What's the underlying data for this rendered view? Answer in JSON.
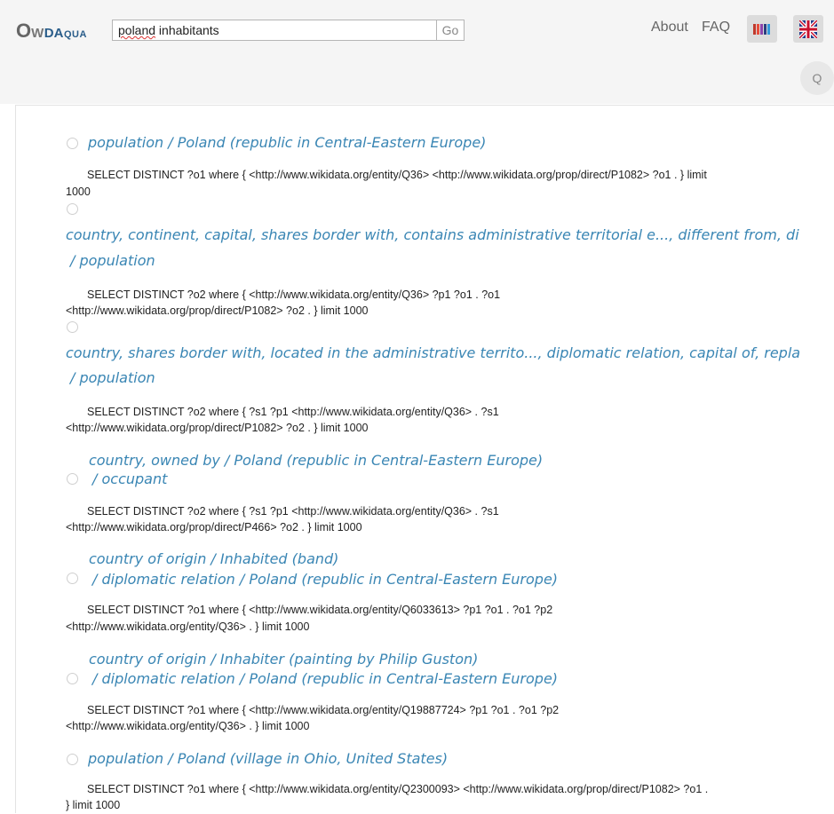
{
  "header": {
    "logo": {
      "o": "O",
      "w": "W",
      "d": "D",
      "aqua": "Aqua"
    },
    "search": {
      "value_word": "poland",
      "value_rest": " inhabitants"
    },
    "go_label": "Go",
    "about_label": "About",
    "faq_label": "FAQ",
    "q_label": "Q"
  },
  "results": [
    {
      "title1": "population / Poland (republic in Central-Eastern Europe)",
      "query1": "SELECT DISTINCT ?o1 where { <http://www.wikidata.org/entity/Q36> <http://www.wikidata.org/prop/direct/P1082> ?o1 . } limit",
      "query2": "1000"
    },
    {
      "title1": "country, continent, capital, shares border with, contains administrative territorial e..., different from, di",
      "title2": "/ population",
      "query1": "SELECT DISTINCT ?o2 where { <http://www.wikidata.org/entity/Q36> ?p1 ?o1 . ?o1",
      "query2": "<http://www.wikidata.org/prop/direct/P1082> ?o2 . } limit 1000"
    },
    {
      "title1": "country, shares border with, located in the administrative territo..., diplomatic relation, capital of, repla",
      "title2": "/ population",
      "query1": "SELECT DISTINCT ?o2 where { ?s1 ?p1 <http://www.wikidata.org/entity/Q36> . ?s1",
      "query2": "<http://www.wikidata.org/prop/direct/P1082> ?o2 . } limit 1000"
    },
    {
      "title1": "country, owned by / Poland (republic in Central-Eastern Europe)",
      "title2": "/ occupant",
      "query1": "SELECT DISTINCT ?o2 where { ?s1 ?p1 <http://www.wikidata.org/entity/Q36> . ?s1",
      "query2": "<http://www.wikidata.org/prop/direct/P466> ?o2 . } limit 1000"
    },
    {
      "title1": "country of origin / Inhabited (band)",
      "title2": "/ diplomatic relation / Poland (republic in Central-Eastern Europe)",
      "query1": "SELECT DISTINCT ?o1 where { <http://www.wikidata.org/entity/Q6033613> ?p1 ?o1 . ?o1 ?p2",
      "query2": "<http://www.wikidata.org/entity/Q36> . } limit 1000"
    },
    {
      "title1": "country of origin / Inhabiter (painting by Philip Guston)",
      "title2": "/ diplomatic relation / Poland (republic in Central-Eastern Europe)",
      "query1": "SELECT DISTINCT ?o1 where { <http://www.wikidata.org/entity/Q19887724> ?p1 ?o1 . ?o1 ?p2",
      "query2": "<http://www.wikidata.org/entity/Q36> . } limit 1000"
    },
    {
      "title1": "population / Poland (village in Ohio, United States)",
      "query1": "SELECT DISTINCT ?o1 where { <http://www.wikidata.org/entity/Q2300093> <http://www.wikidata.org/prop/direct/P1082> ?o1 .",
      "query2": "} limit 1000"
    }
  ]
}
